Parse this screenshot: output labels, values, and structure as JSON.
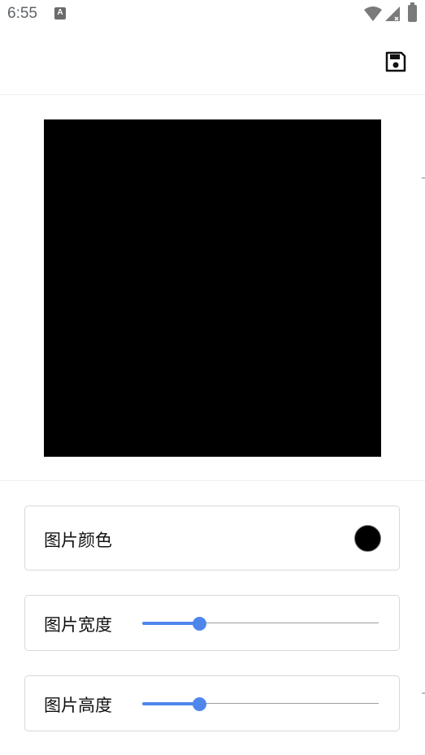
{
  "status_bar": {
    "time": "6:55",
    "notification_glyph": "A",
    "icons": [
      "wifi-icon",
      "signal-icon",
      "battery-icon"
    ]
  },
  "app_bar": {
    "save_icon": "save-floppy-icon"
  },
  "preview": {
    "image_color": "#000000"
  },
  "settings": {
    "color_row": {
      "label": "图片颜色",
      "swatch_color": "#000000"
    },
    "width_row": {
      "label": "图片宽度",
      "value_fraction": 0.24
    },
    "height_row": {
      "label": "图片高度",
      "value_fraction": 0.24
    }
  },
  "colors": {
    "accent": "#4f86ec",
    "track": "#9e9e9e",
    "border": "#d8d8d8"
  }
}
